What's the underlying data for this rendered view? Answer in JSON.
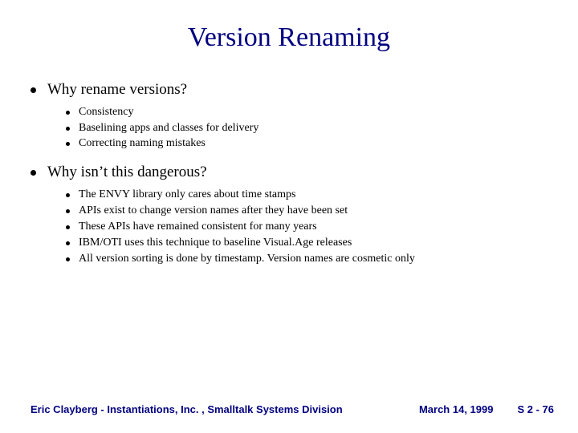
{
  "title": "Version Renaming",
  "sections": [
    {
      "heading": "Why rename versions?",
      "items": [
        "Consistency",
        "Baselining apps and classes for delivery",
        "Correcting naming mistakes"
      ]
    },
    {
      "heading": "Why isn’t this dangerous?",
      "items": [
        "The ENVY library only cares about time stamps",
        "APIs exist to change version names after they have been set",
        "These APIs have remained consistent for many years",
        "IBM/OTI uses this technique to baseline Visual.Age releases",
        "All version sorting is done by timestamp. Version names are cosmetic only"
      ]
    }
  ],
  "footer": {
    "author": "Eric Clayberg - Instantiations, Inc. , Smalltalk Systems Division",
    "date": "March 14, 1999",
    "page": "S 2 - 76"
  }
}
